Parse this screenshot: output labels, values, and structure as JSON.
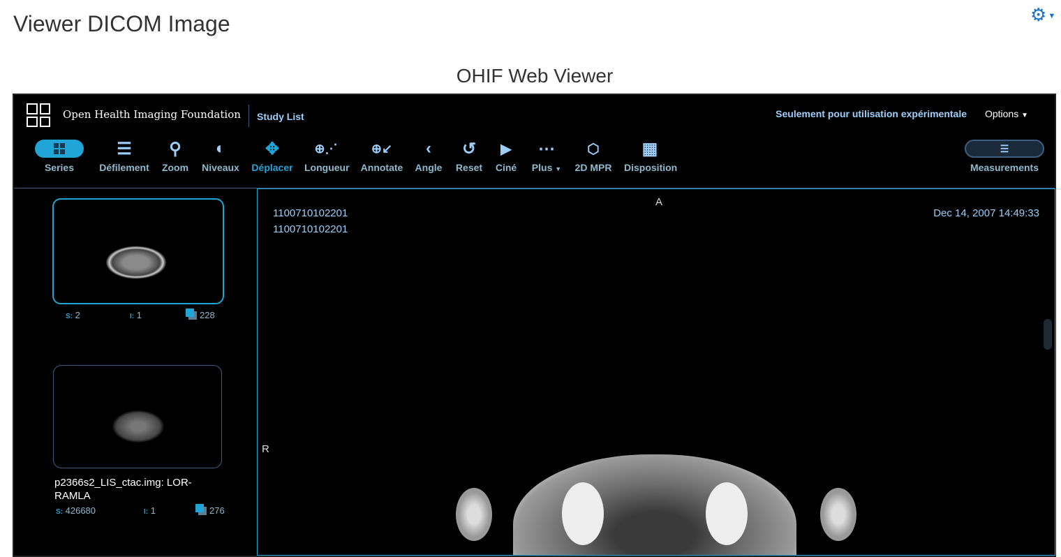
{
  "page": {
    "title": "Viewer DICOM Image",
    "subtitle": "OHIF Web Viewer"
  },
  "header": {
    "brand": "Open Health Imaging Foundation",
    "study_list": "Study List",
    "notice": "Seulement pour utilisation expérimentale",
    "options": "Options"
  },
  "toolbar": {
    "series": "Series",
    "tools": [
      "Défilement",
      "Zoom",
      "Niveaux",
      "Déplacer",
      "Longueur",
      "Annotate",
      "Angle",
      "Reset",
      "Ciné",
      "Plus",
      "2D MPR",
      "Disposition"
    ],
    "measurements": "Measurements"
  },
  "series": [
    {
      "name": "",
      "s_label": "S:",
      "s": "2",
      "i_label": "I:",
      "i": "1",
      "count": "228"
    },
    {
      "name": "p2366s2_LIS_ctac.img: LOR-RAMLA",
      "s_label": "S:",
      "s": "426680",
      "i_label": "I:",
      "i": "1",
      "count": "276"
    }
  ],
  "viewport": {
    "top_label": "A",
    "left_label": "R",
    "line1": "1100710102201",
    "line2": "1100710102201",
    "datetime": "Dec 14, 2007 14:49:33"
  },
  "colors": {
    "accent": "#20a5d6",
    "text": "#9ccef9"
  }
}
